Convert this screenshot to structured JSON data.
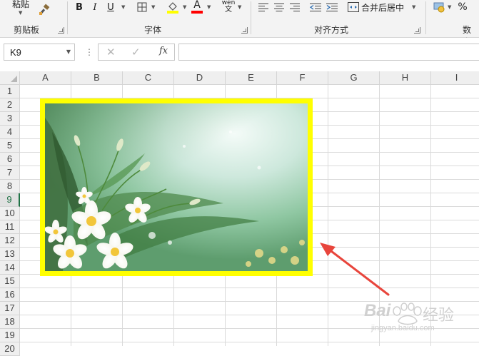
{
  "ribbon": {
    "clipboard": {
      "paste_label": "粘贴",
      "group_label": "剪贴板"
    },
    "font": {
      "bold": "B",
      "italic": "I",
      "underline": "U",
      "font_color_glyph": "A",
      "phonetic_top": "wén",
      "phonetic_bottom": "文",
      "group_label": "字体",
      "fill_color": "#ffff00",
      "font_color": "#ff0000"
    },
    "alignment": {
      "merge_label": "合并后居中",
      "group_label": "对齐方式"
    },
    "number": {
      "percent": "%",
      "group_label": "数字"
    }
  },
  "formula_bar": {
    "name_box": "K9",
    "dots": "⋮",
    "cancel": "✕",
    "enter": "✓",
    "fx": "fx",
    "formula": ""
  },
  "grid": {
    "columns": [
      "A",
      "B",
      "C",
      "D",
      "E",
      "F",
      "G",
      "H",
      "I"
    ],
    "rows": [
      "1",
      "2",
      "3",
      "4",
      "5",
      "6",
      "7",
      "8",
      "9",
      "10",
      "11",
      "12",
      "13",
      "14",
      "15",
      "16",
      "17",
      "18",
      "19",
      "20"
    ],
    "active_row": "9"
  },
  "picture": {
    "border_color": "#ffff00",
    "alt": "flower-picture"
  },
  "annotation": {
    "arrow_color": "#e8453c"
  },
  "watermark": {
    "brand": "Bai",
    "brand_cn": "经验",
    "url": "jingyan.baidu.com"
  }
}
